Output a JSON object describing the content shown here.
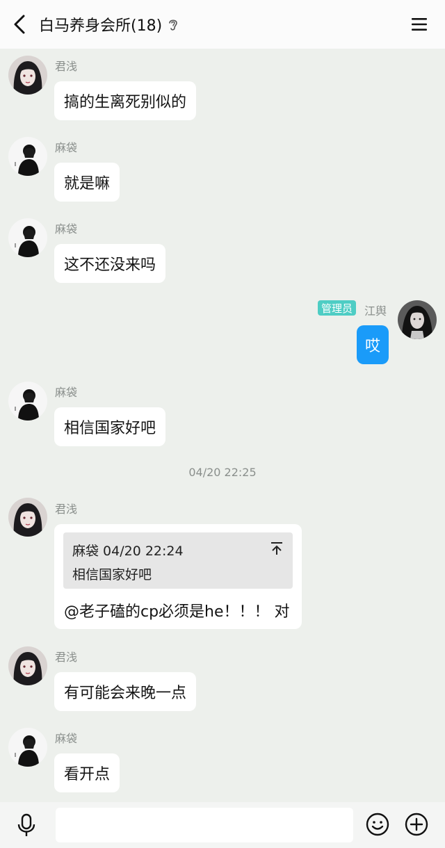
{
  "header": {
    "title": "白马养身会所(18)",
    "back_icon": "chevron-left-icon",
    "ear_icon": "ear-icon",
    "menu_icon": "hamburger-menu-icon"
  },
  "messages": [
    {
      "sender": "君浅",
      "text": "搞的生离死别似的"
    },
    {
      "sender": "麻袋",
      "text": "就是嘛"
    },
    {
      "sender": "麻袋",
      "text": "这不还没来吗"
    },
    {
      "sender": "江舆",
      "badge": "管理员",
      "text": "哎",
      "mine": true
    },
    {
      "sender": "麻袋",
      "text": "相信国家好吧"
    },
    {
      "sender": "君浅",
      "quote_meta": "麻袋 04/20 22:24",
      "quote_text": "相信国家好吧",
      "text": "@老子磕的cp必须是he！！！ 对"
    },
    {
      "sender": "君浅",
      "text": "有可能会来晚一点"
    },
    {
      "sender": "麻袋",
      "text": "看开点"
    }
  ],
  "timestamp": "04/20 22:25",
  "input": {
    "placeholder": "",
    "value": ""
  },
  "colors": {
    "accent": "#1a9bf9",
    "badge": "#4ecdc4",
    "background": "#edf0ec"
  }
}
